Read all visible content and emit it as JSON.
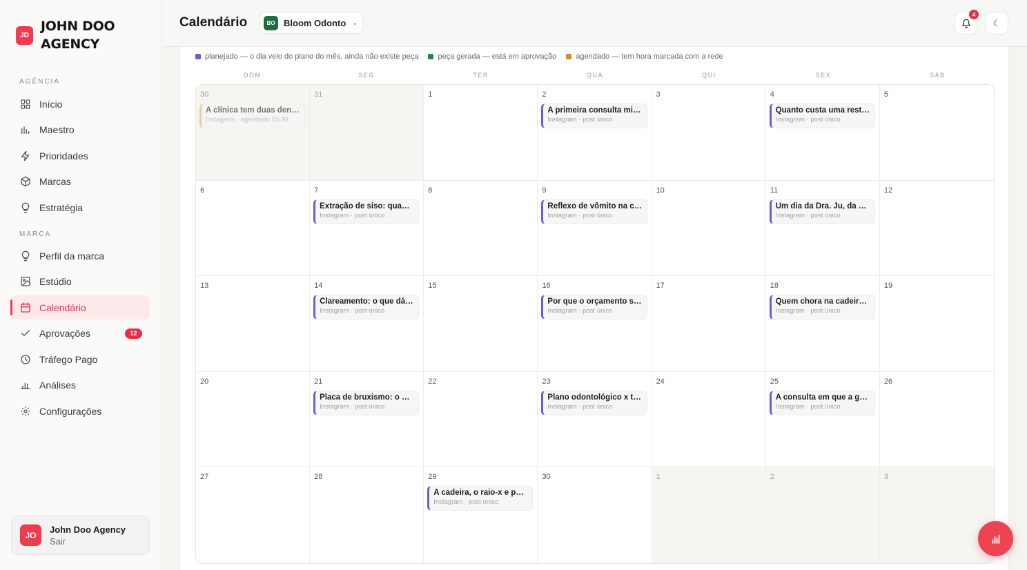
{
  "sidebar": {
    "logo": {
      "badge": "JD",
      "title": "JOHN DOO AGENCY"
    },
    "sections": {
      "agency": "AGÊNCIA",
      "brand": "MARCA"
    },
    "agency_items": [
      {
        "label": "Início",
        "icon": "grid-icon"
      },
      {
        "label": "Maestro",
        "icon": "bars-icon"
      },
      {
        "label": "Prioridades",
        "icon": "bolt-icon"
      },
      {
        "label": "Marcas",
        "icon": "cube-icon"
      },
      {
        "label": "Estratégia",
        "icon": "bulb-icon"
      }
    ],
    "brand_items": [
      {
        "label": "Perfil da marca",
        "icon": "bulb-icon"
      },
      {
        "label": "Estúdio",
        "icon": "image-icon"
      },
      {
        "label": "Calendário",
        "icon": "calendar-icon",
        "active": true
      },
      {
        "label": "Aprovações",
        "icon": "check-icon",
        "count": "12"
      },
      {
        "label": "Tráfego Pago",
        "icon": "clock-icon"
      },
      {
        "label": "Análises",
        "icon": "chart-icon"
      },
      {
        "label": "Configurações",
        "icon": "gear-icon"
      }
    ],
    "user": {
      "initials": "JO",
      "name": "John Doo Agency",
      "logout": "Sair"
    }
  },
  "header": {
    "title": "Calendário",
    "brand_selector": {
      "badge": "BO",
      "name": "Bloom Odonto"
    },
    "notifications_count": "4"
  },
  "legend": [
    {
      "label": "planejado — o dia veio do plano do mês, ainda não existe peça",
      "color": "#6a5ae0"
    },
    {
      "label": "peça gerada — está em aprovação",
      "color": "#1f8a48"
    },
    {
      "label": "agendado — tem hora marcada com a rede",
      "color": "#e08a1e"
    }
  ],
  "weekdays": [
    "DOM",
    "SEG",
    "TER",
    "QUA",
    "QUI",
    "SEX",
    "SÁB"
  ],
  "days": [
    {
      "n": "30",
      "other": true,
      "event": {
        "title": "A clínica tem duas dent…",
        "sub": "Instagram · agendado 15:30",
        "status": "scheduled"
      }
    },
    {
      "n": "31",
      "other": true
    },
    {
      "n": "1"
    },
    {
      "n": "2",
      "event": {
        "title": "A primeira consulta mi…",
        "sub": "Instagram · post único"
      }
    },
    {
      "n": "3"
    },
    {
      "n": "4",
      "event": {
        "title": "Quanto custa uma rest…",
        "sub": "Instagram · post único"
      }
    },
    {
      "n": "5"
    },
    {
      "n": "6"
    },
    {
      "n": "7",
      "event": {
        "title": "Extração de siso: quan…",
        "sub": "Instagram · post único"
      }
    },
    {
      "n": "8"
    },
    {
      "n": "9",
      "event": {
        "title": "Reflexo de vômito na c…",
        "sub": "Instagram · post único"
      }
    },
    {
      "n": "10"
    },
    {
      "n": "11",
      "event": {
        "title": "Um dia da Dra. Ju, da p…",
        "sub": "Instagram · post único"
      }
    },
    {
      "n": "12"
    },
    {
      "n": "13"
    },
    {
      "n": "14",
      "event": {
        "title": "Clareamento: o que dá …",
        "sub": "Instagram · post único"
      }
    },
    {
      "n": "15"
    },
    {
      "n": "16",
      "event": {
        "title": "Por que o orçamento s…",
        "sub": "Instagram · post único"
      }
    },
    {
      "n": "17"
    },
    {
      "n": "18",
      "event": {
        "title": "Quem chora na cadeira…",
        "sub": "Instagram · post único"
      }
    },
    {
      "n": "19"
    },
    {
      "n": "20"
    },
    {
      "n": "21",
      "event": {
        "title": "Placa de bruxismo: o q…",
        "sub": "Instagram · post único"
      }
    },
    {
      "n": "22"
    },
    {
      "n": "23",
      "event": {
        "title": "Plano odontológico x tr…",
        "sub": "Instagram · post único"
      }
    },
    {
      "n": "24"
    },
    {
      "n": "25",
      "event": {
        "title": "A consulta em que a ge…",
        "sub": "Instagram · post único"
      }
    },
    {
      "n": "26"
    },
    {
      "n": "27"
    },
    {
      "n": "28"
    },
    {
      "n": "29",
      "event": {
        "title": "A cadeira, o raio-x e po…",
        "sub": "Instagram · post único"
      }
    },
    {
      "n": "30"
    },
    {
      "n": "1",
      "other": true
    },
    {
      "n": "2",
      "other": true
    },
    {
      "n": "3",
      "other": true
    }
  ],
  "fab_icon": "chart-bars-icon"
}
